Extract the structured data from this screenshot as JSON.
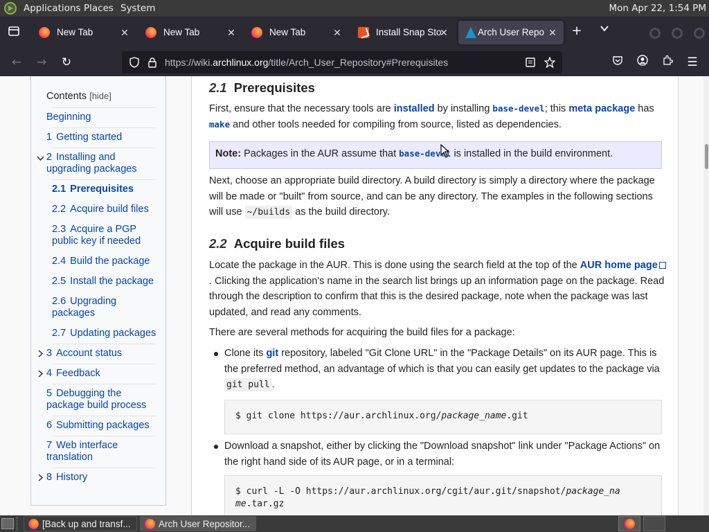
{
  "top_panel": {
    "menus": [
      "Applications",
      "Places",
      "System"
    ],
    "clock": "Mon Apr 22,  1:54 PM"
  },
  "tabs": [
    {
      "title": "New Tab",
      "icon": "firefox-icon"
    },
    {
      "title": "New Tab",
      "icon": "firefox-icon"
    },
    {
      "title": "New Tab",
      "icon": "firefox-icon"
    },
    {
      "title": "Install Snap Store",
      "icon": "snapcraft-icon"
    },
    {
      "title": "Arch User Repository",
      "icon": "archlinux-icon",
      "active": true
    }
  ],
  "nav": {
    "url_prefix": "https://wiki.",
    "url_domain": "archlinux.org",
    "url_path": "/title/Arch_User_Repository#Prerequisites"
  },
  "toc": {
    "heading": "Contents",
    "hide": "[hide]",
    "items": [
      {
        "num": "",
        "text": "Beginning"
      },
      {
        "num": "1",
        "text": "Getting started"
      },
      {
        "num": "2",
        "text": "Installing and upgrading packages",
        "line1": "Installing and",
        "line2": "upgrading packages"
      },
      {
        "num": "2.1",
        "text": "Prerequisites"
      },
      {
        "num": "2.2",
        "text": "Acquire build files"
      },
      {
        "num": "2.3",
        "text": "Acquire a PGP public key if needed",
        "line1": "Acquire a PGP",
        "line2": "public key if needed"
      },
      {
        "num": "2.4",
        "text": "Build the package"
      },
      {
        "num": "2.5",
        "text": "Install the package"
      },
      {
        "num": "2.6",
        "text": "Upgrading packages",
        "line1": "Upgrading",
        "line2": "packages"
      },
      {
        "num": "2.7",
        "text": "Updating packages"
      },
      {
        "num": "3",
        "text": "Account status"
      },
      {
        "num": "4",
        "text": "Feedback"
      },
      {
        "num": "5",
        "text": "Debugging the package build process",
        "line1": "Debugging the",
        "line2": "package build process"
      },
      {
        "num": "6",
        "text": "Submitting packages"
      },
      {
        "num": "7",
        "text": "Web interface translation",
        "line1": "Web interface",
        "line2": "translation"
      },
      {
        "num": "8",
        "text": "History"
      }
    ]
  },
  "article": {
    "s21": {
      "num": "2.1",
      "title": "Prerequisites"
    },
    "p1": {
      "a": "First, ensure that the necessary tools are ",
      "installed": "installed",
      "b": " by installing ",
      "base_devel": "base-devel",
      "c": "; this ",
      "meta_package": "meta package",
      "d": " has",
      "make": "make",
      "e": " and other tools needed for compiling from source, listed as dependencies."
    },
    "note": {
      "label": "Note:",
      "a": " Packages in the AUR assume that ",
      "code": "base-devel",
      "b": " is installed in the build environment."
    },
    "p2": {
      "a": "Next, choose an appropriate build directory. A build directory is simply a directory where the package will be made or \"built\" from source, and can be any directory. The examples in the following sections will use ",
      "code": "~/builds",
      "b": " as the build directory."
    },
    "s22": {
      "num": "2.2",
      "title": "Acquire build files"
    },
    "p3": {
      "a": "Locate the package in the AUR. This is done using the search field at the top of the ",
      "link": "AUR home page",
      "b": ". Clicking the application's name in the search list brings up an information page on the package. Read through the description to confirm that this is the desired package, note when the package was last updated, and read any comments."
    },
    "p4": "There are several methods for acquiring the build files for a package:",
    "li1": {
      "a": "Clone its ",
      "git": "git",
      "b": " repository, labeled \"Git Clone URL\" in the \"Package Details\" on its AUR page. This is the preferred method, an advantage of which is that you can easily get updates to the package via ",
      "code": "git pull",
      "c": "."
    },
    "pre1": {
      "a": "$ git clone https://aur.archlinux.org/",
      "i": "package_name",
      "b": ".git"
    },
    "li2": "Download a snapshot, either by clicking the \"Download snapshot\" link under \"Package Actions\" on the right hand side of its AUR page, or in a terminal:",
    "pre2": {
      "a": "$ curl -L -O https://aur.archlinux.org/cgit/aur.git/snapshot/",
      "i1": "package_na",
      "i2": "me",
      "b": ".tar.gz"
    }
  },
  "taskbar": {
    "items": [
      {
        "label": "[Back up and transf...",
        "icon": "firefox-icon"
      },
      {
        "label": "Arch User Repositor...",
        "icon": "firefox-icon",
        "active": true
      }
    ]
  },
  "colors": {
    "link": "#0645ad",
    "tab_bg": "#2b2a33",
    "active_tab": "#42414d",
    "note_bg": "#ebebff"
  }
}
